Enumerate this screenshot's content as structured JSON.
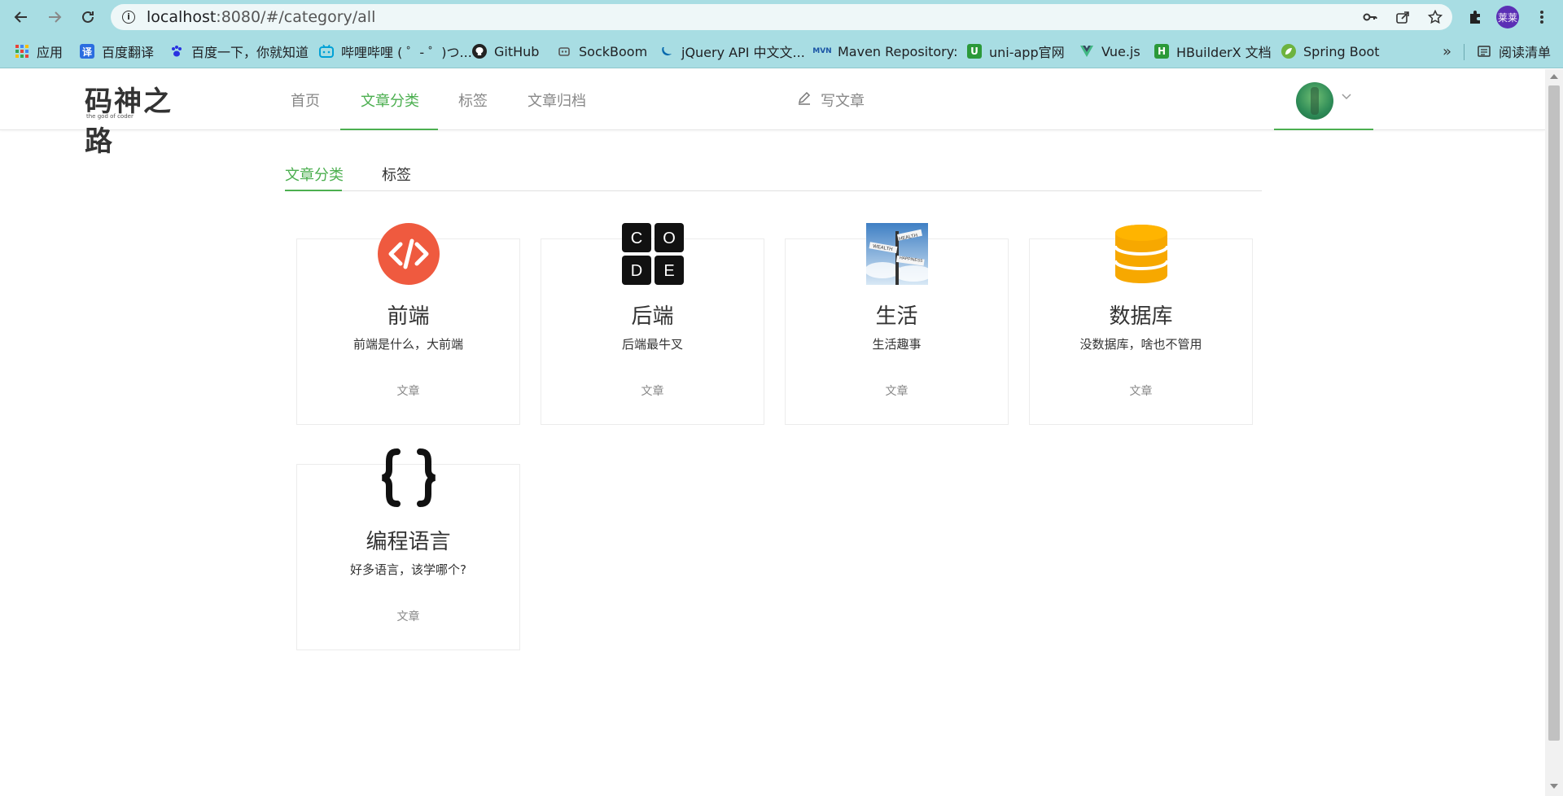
{
  "browser": {
    "url_host": "localhost",
    "url_path": ":8080/#/category/all",
    "profile_initials": "莱莱"
  },
  "bookmarks": [
    {
      "label": "应用",
      "icon": "apps-grid-icon"
    },
    {
      "label": "百度翻译",
      "icon": "baidu-translate-icon"
    },
    {
      "label": "百度一下，你就知道",
      "icon": "baidu-paw-icon"
    },
    {
      "label": "哔哩哔哩 ( ゜- ゜)つ...",
      "icon": "bilibili-icon"
    },
    {
      "label": "GitHub",
      "icon": "github-icon"
    },
    {
      "label": "SockBoom",
      "icon": "sockboom-icon"
    },
    {
      "label": "jQuery API 中文文...",
      "icon": "jquery-icon"
    },
    {
      "label": "Maven Repository:",
      "icon": "maven-icon"
    },
    {
      "label": "uni-app官网",
      "icon": "uniapp-icon"
    },
    {
      "label": "Vue.js",
      "icon": "vue-icon"
    },
    {
      "label": "HBuilderX 文档",
      "icon": "hbuilderx-icon"
    },
    {
      "label": "Spring Boot",
      "icon": "spring-icon"
    }
  ],
  "bookmarks_more": "»",
  "reading_list": "阅读清单",
  "site": {
    "logo_text": "码神之路",
    "logo_sub": "the god of coder",
    "nav": [
      "首页",
      "文章分类",
      "标签",
      "文章归档"
    ],
    "write_label": "写文章",
    "accent_color": "#4caf50"
  },
  "tabs": [
    "文章分类",
    "标签"
  ],
  "categories": [
    {
      "title": "前端",
      "desc": "前端是什么，大前端",
      "meta": "文章",
      "icon": "code-brackets-icon"
    },
    {
      "title": "后端",
      "desc": "后端最牛叉",
      "meta": "文章",
      "icon": "code-letters-icon"
    },
    {
      "title": "生活",
      "desc": "生活趣事",
      "meta": "文章",
      "icon": "signpost-icon"
    },
    {
      "title": "数据库",
      "desc": "没数据库，啥也不管用",
      "meta": "文章",
      "icon": "database-icon"
    },
    {
      "title": "编程语言",
      "desc": "好多语言，该学哪个?",
      "meta": "文章",
      "icon": "curly-braces-icon"
    }
  ],
  "code_letters": [
    "C",
    "O",
    "D",
    "E"
  ],
  "signpost_words": [
    "WEALTH",
    "HEALTH",
    "HAPPINESS"
  ]
}
